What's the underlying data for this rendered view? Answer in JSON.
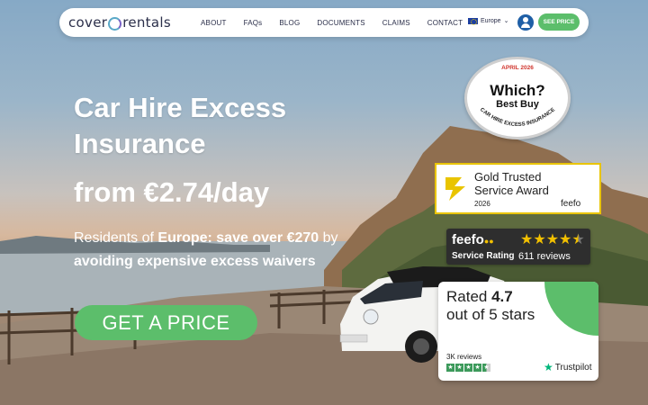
{
  "nav": {
    "logo_left": "cover",
    "logo_right": "rentals",
    "links": [
      "ABOUT",
      "FAQs",
      "BLOG",
      "DOCUMENTS",
      "CLAIMS",
      "CONTACT"
    ],
    "region": "Europe",
    "see_price": "SEE PRICE"
  },
  "hero": {
    "title_line1": "Car Hire Excess",
    "title_line2": "Insurance",
    "price": "from €2.74/day",
    "sub_prefix": "Residents of ",
    "sub_bold": "Europe: save over €270",
    "sub_mid": " by",
    "sub_bold2": "avoiding expensive excess waivers",
    "cta": "GET A PRICE"
  },
  "which": {
    "date": "APRIL 2026",
    "brand": "Which?",
    "award": "Best Buy",
    "arc_text": "CAR HIRE EXCESS INSURANCE"
  },
  "gold_award": {
    "line1": "Gold Trusted",
    "line2": "Service Award",
    "year": "2026",
    "logo": "feefo"
  },
  "feefo": {
    "logo": "feefo",
    "label": "Service Rating",
    "reviews": "611 reviews",
    "rating": 4.5
  },
  "trustpilot": {
    "rated_prefix": "Rated ",
    "rating": "4.7",
    "rated_suffix": "out of 5 stars",
    "count": "3K reviews",
    "logo": "Trustpilot"
  },
  "colors": {
    "brand_green": "#5cbe6b",
    "navy": "#2b2f4a",
    "which_red": "#d0342c",
    "feefo_yellow": "#f2c000",
    "trustpilot_green": "#00b67a"
  }
}
